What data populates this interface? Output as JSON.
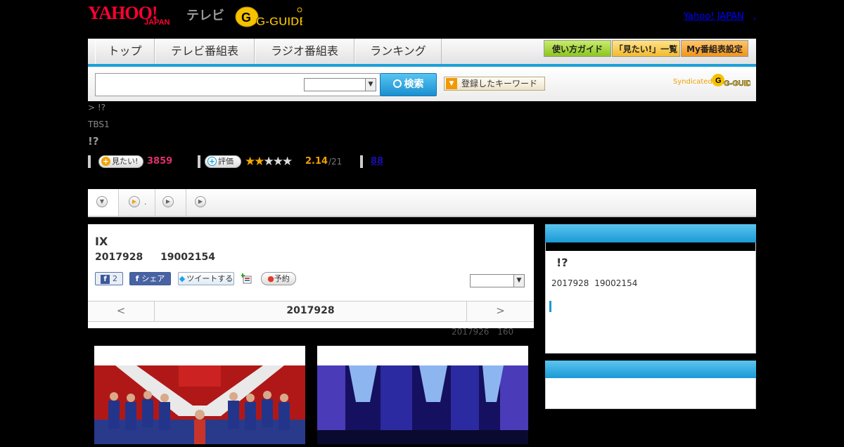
{
  "header": {
    "logo_yahoo": "YAHOO!",
    "logo_japan": "JAPAN",
    "logo_tv": "テレビ",
    "logo_gguide": "G-GUIDE",
    "yahoo_link": "Yahoo! JAPAN",
    "yahoo_link_sep": ","
  },
  "nav": {
    "tabs": [
      {
        "label": "トップ"
      },
      {
        "label": "テレビ番組表"
      },
      {
        "label": "ラジオ番組表"
      },
      {
        "label": "ランキング"
      }
    ],
    "buttons": [
      {
        "label": "使い方ガイド",
        "color": "#9ed234"
      },
      {
        "label": "「見たい!」一覧",
        "color": "#f6c84a"
      },
      {
        "label": "My番組表設定",
        "color": "#f5a623"
      }
    ],
    "accent": "#1aa0d8"
  },
  "search": {
    "input_value": "",
    "select_value": "",
    "button_label": "検索",
    "keyword_button": "登録したキーワード",
    "syndicated_label": "Syndicated",
    "syndicated_logo": "G-GUIDE"
  },
  "program": {
    "breadcrumb": "> !?",
    "channel": "TBS1",
    "title": "!?",
    "mitai_button": "見たい!",
    "mitai_count": "3859",
    "rate_button": "評価",
    "rating_value": "2.14",
    "rating_stars": 2.14,
    "rating_max": 5,
    "rating_total": "/21",
    "review_count": "88"
  },
  "tabs": [
    {
      "icon": "down-circle-icon",
      "label": ""
    },
    {
      "icon": "play-circle-icon",
      "label": "."
    },
    {
      "icon": "play-circle-icon",
      "label": ""
    },
    {
      "icon": "play-circle-icon",
      "label": ""
    }
  ],
  "main": {
    "title": "IX",
    "date": "2017928 19002154",
    "fb_like_count": "2",
    "fb_share": "シェア",
    "tweet": "ツイートする",
    "reserve": "予約",
    "select_value": "",
    "pager_prev": "<",
    "pager_date": "2017928",
    "pager_next": ">",
    "update_note": "2017926 160"
  },
  "sidebar": {
    "box1_title": "!?",
    "box1_date": "2017928 19002154"
  }
}
